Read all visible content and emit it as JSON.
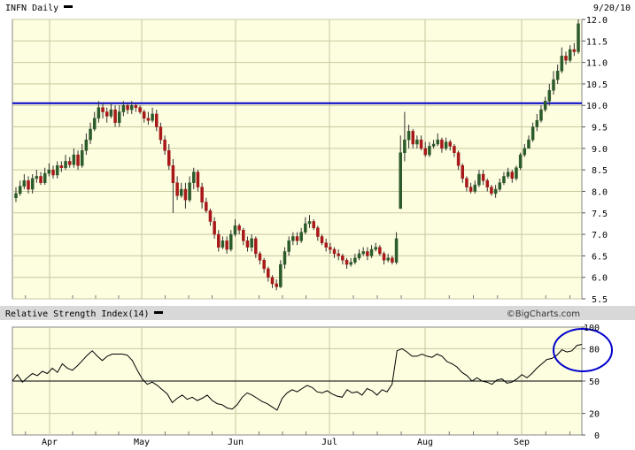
{
  "header": {
    "symbol": "INFN Daily",
    "date": "9/20/10"
  },
  "brand": "©BigCharts.com",
  "colors": {
    "plot_background": "#fdfde0",
    "grid": "#c8c8a0",
    "bull_candle": "#2b5a2b",
    "bear_candle": "#a81818",
    "wick": "#333333",
    "resistance_line": "#0000cc",
    "rsi_line": "#000000",
    "annotation_circle": "#0000cc",
    "divider": "#d8d8d8"
  },
  "chart_data": [
    {
      "type": "candlestick",
      "title": "INFN Daily",
      "ylim": [
        5.5,
        12.0
      ],
      "yticks": [
        "5.5",
        "6.0",
        "6.5",
        "7.0",
        "7.5",
        "8.0",
        "8.5",
        "9.0",
        "9.5",
        "10.0",
        "10.5",
        "11.0",
        "11.5",
        "12.0"
      ],
      "x_labels": [
        "Apr",
        "May",
        "Jun",
        "Jul",
        "Aug",
        "Sep"
      ],
      "grid": true,
      "horizontal_line": {
        "value": 10.05
      },
      "close": [
        7.95,
        8.12,
        8.25,
        8.05,
        8.3,
        8.35,
        8.2,
        8.42,
        8.5,
        8.38,
        8.6,
        8.55,
        8.7,
        8.62,
        8.85,
        8.6,
        8.95,
        9.2,
        9.45,
        9.7,
        9.95,
        9.85,
        9.75,
        9.9,
        9.6,
        9.85,
        10.0,
        9.9,
        10.0,
        9.95,
        9.85,
        9.7,
        9.65,
        9.8,
        9.5,
        9.2,
        8.95,
        8.6,
        8.2,
        7.9,
        8.05,
        7.8,
        8.2,
        8.45,
        8.1,
        7.75,
        7.55,
        7.3,
        7.0,
        6.7,
        6.85,
        6.65,
        7.0,
        7.2,
        7.1,
        6.85,
        6.7,
        6.9,
        6.55,
        6.4,
        6.2,
        6.0,
        5.85,
        5.78,
        6.3,
        6.6,
        6.85,
        6.95,
        6.85,
        7.05,
        7.25,
        7.3,
        7.15,
        6.95,
        6.8,
        6.7,
        6.65,
        6.55,
        6.5,
        6.4,
        6.3,
        6.35,
        6.45,
        6.55,
        6.6,
        6.5,
        6.65,
        6.7,
        6.55,
        6.4,
        6.45,
        6.35,
        6.9,
        8.9,
        9.2,
        9.4,
        9.1,
        9.2,
        9.0,
        8.85,
        9.05,
        9.1,
        9.2,
        9.0,
        9.15,
        9.05,
        8.9,
        8.6,
        8.3,
        8.1,
        8.0,
        8.15,
        8.4,
        8.25,
        8.1,
        7.95,
        8.05,
        8.2,
        8.35,
        8.45,
        8.3,
        8.55,
        8.85,
        9.0,
        9.2,
        9.5,
        9.65,
        9.9,
        10.1,
        10.35,
        10.6,
        10.8,
        11.15,
        11.05,
        11.3,
        11.25,
        11.9
      ],
      "open": [
        7.85,
        7.95,
        8.12,
        8.25,
        8.05,
        8.3,
        8.35,
        8.2,
        8.42,
        8.5,
        8.38,
        8.6,
        8.55,
        8.7,
        8.62,
        8.85,
        8.6,
        8.95,
        9.2,
        9.45,
        9.7,
        9.95,
        9.85,
        9.75,
        9.9,
        9.6,
        9.85,
        10.0,
        9.9,
        10.0,
        9.95,
        9.85,
        9.7,
        9.65,
        9.8,
        9.5,
        9.2,
        8.95,
        8.6,
        8.2,
        7.9,
        8.05,
        7.8,
        8.2,
        8.45,
        8.1,
        7.75,
        7.55,
        7.3,
        7.0,
        6.7,
        6.85,
        6.65,
        7.0,
        7.2,
        7.1,
        6.85,
        6.7,
        6.9,
        6.55,
        6.4,
        6.2,
        6.0,
        5.85,
        5.78,
        6.3,
        6.6,
        6.85,
        6.95,
        6.85,
        7.05,
        7.25,
        7.3,
        7.15,
        6.95,
        6.8,
        6.7,
        6.65,
        6.55,
        6.5,
        6.4,
        6.3,
        6.35,
        6.45,
        6.55,
        6.6,
        6.5,
        6.65,
        6.7,
        6.55,
        6.4,
        6.45,
        6.35,
        7.6,
        8.9,
        9.2,
        9.4,
        9.1,
        9.2,
        9.0,
        8.85,
        9.05,
        9.1,
        9.2,
        9.0,
        9.15,
        9.05,
        8.9,
        8.6,
        8.3,
        8.1,
        8.0,
        8.15,
        8.4,
        8.25,
        8.1,
        7.95,
        8.05,
        8.2,
        8.35,
        8.45,
        8.3,
        8.55,
        8.85,
        9.0,
        9.2,
        9.5,
        9.65,
        9.9,
        10.1,
        10.35,
        10.6,
        10.8,
        11.15,
        11.05,
        11.3,
        11.25
      ],
      "high": [
        8.1,
        8.25,
        8.4,
        8.35,
        8.4,
        8.5,
        8.45,
        8.55,
        8.65,
        8.6,
        8.7,
        8.7,
        8.85,
        8.8,
        9.0,
        8.95,
        9.1,
        9.35,
        9.6,
        9.85,
        10.1,
        10.05,
        9.95,
        10.05,
        10.0,
        10.0,
        10.1,
        10.05,
        10.1,
        10.05,
        10.0,
        9.9,
        9.85,
        9.95,
        9.9,
        9.6,
        9.3,
        9.1,
        8.75,
        8.35,
        8.2,
        8.2,
        8.35,
        8.55,
        8.5,
        8.2,
        7.85,
        7.6,
        7.4,
        7.1,
        6.95,
        6.95,
        7.1,
        7.35,
        7.25,
        7.15,
        6.95,
        7.0,
        6.95,
        6.6,
        6.45,
        6.25,
        6.05,
        5.95,
        6.4,
        6.7,
        6.95,
        7.05,
        7.05,
        7.15,
        7.4,
        7.45,
        7.35,
        7.2,
        7.0,
        6.9,
        6.8,
        6.7,
        6.65,
        6.55,
        6.45,
        6.45,
        6.55,
        6.65,
        6.7,
        6.7,
        6.75,
        6.8,
        6.75,
        6.6,
        6.55,
        6.5,
        7.05,
        9.3,
        9.85,
        9.55,
        9.45,
        9.3,
        9.3,
        9.15,
        9.15,
        9.2,
        9.35,
        9.25,
        9.25,
        9.2,
        9.1,
        8.95,
        8.65,
        8.35,
        8.2,
        8.25,
        8.5,
        8.5,
        8.3,
        8.15,
        8.15,
        8.3,
        8.45,
        8.55,
        8.5,
        8.6,
        8.9,
        9.1,
        9.3,
        9.6,
        9.8,
        10.0,
        10.2,
        10.5,
        10.8,
        10.95,
        11.35,
        11.25,
        11.4,
        11.45,
        12.0
      ],
      "low": [
        7.75,
        7.9,
        8.05,
        7.95,
        7.95,
        8.2,
        8.15,
        8.15,
        8.35,
        8.3,
        8.3,
        8.45,
        8.5,
        8.55,
        8.55,
        8.5,
        8.55,
        8.85,
        9.1,
        9.4,
        9.6,
        9.7,
        9.6,
        9.7,
        9.5,
        9.5,
        9.75,
        9.8,
        9.8,
        9.85,
        9.8,
        9.6,
        9.55,
        9.6,
        9.4,
        9.1,
        8.85,
        8.5,
        7.5,
        7.8,
        7.85,
        7.6,
        7.75,
        8.05,
        8.0,
        7.6,
        7.5,
        7.2,
        6.9,
        6.6,
        6.65,
        6.55,
        6.6,
        6.95,
        7.0,
        6.75,
        6.6,
        6.6,
        6.45,
        6.3,
        6.1,
        5.9,
        5.75,
        5.7,
        5.75,
        6.2,
        6.5,
        6.75,
        6.75,
        6.8,
        7.0,
        7.15,
        7.1,
        6.85,
        6.75,
        6.6,
        6.55,
        6.45,
        6.4,
        6.3,
        6.2,
        6.25,
        6.3,
        6.4,
        6.5,
        6.4,
        6.45,
        6.6,
        6.5,
        6.3,
        6.35,
        6.3,
        6.3,
        7.6,
        8.7,
        9.0,
        9.0,
        9.0,
        8.95,
        8.8,
        8.8,
        9.0,
        9.05,
        8.9,
        8.95,
        8.95,
        8.8,
        8.5,
        8.2,
        8.0,
        7.95,
        7.95,
        8.1,
        8.15,
        8.0,
        7.9,
        7.85,
        8.0,
        8.15,
        8.3,
        8.2,
        8.25,
        8.5,
        8.8,
        9.0,
        9.15,
        9.4,
        9.6,
        9.85,
        10.0,
        10.25,
        10.5,
        10.75,
        10.95,
        11.0,
        11.15,
        11.2
      ]
    },
    {
      "type": "line",
      "title": "Relative Strength Index(14)",
      "ylim": [
        0,
        100
      ],
      "yticks": [
        "0",
        "20",
        "50",
        "80",
        "100"
      ],
      "grid": true,
      "reference_line": {
        "value": 50
      },
      "circle_annotation": true,
      "values": [
        50,
        56,
        49,
        53,
        57,
        55,
        59,
        57,
        62,
        58,
        66,
        62,
        60,
        64,
        69,
        74,
        78,
        73,
        69,
        73,
        75,
        75,
        75,
        74,
        69,
        60,
        52,
        47,
        49,
        46,
        42,
        38,
        30,
        34,
        37,
        33,
        35,
        32,
        34,
        37,
        32,
        29,
        28,
        25,
        24,
        28,
        35,
        39,
        37,
        34,
        31,
        29,
        26,
        23,
        34,
        39,
        42,
        40,
        43,
        46,
        44,
        40,
        39,
        41,
        38,
        36,
        35,
        42,
        39,
        40,
        37,
        43,
        41,
        37,
        42,
        40,
        47,
        78,
        80,
        77,
        73,
        73,
        75,
        73,
        72,
        75,
        73,
        68,
        66,
        63,
        58,
        55,
        50,
        53,
        50,
        49,
        47,
        51,
        52,
        48,
        49,
        52,
        56,
        53,
        57,
        62,
        66,
        70,
        71,
        74,
        79,
        77,
        78,
        83,
        84
      ]
    }
  ]
}
